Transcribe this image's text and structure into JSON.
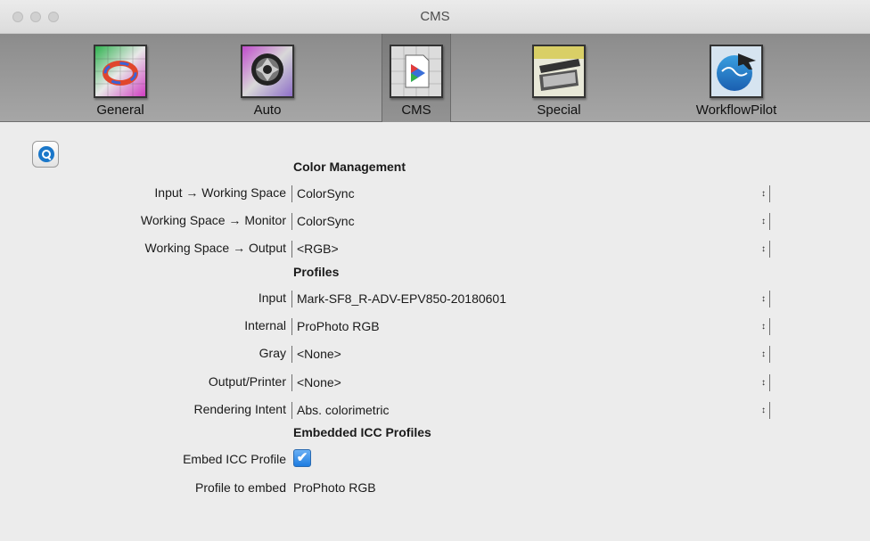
{
  "window": {
    "title": "CMS"
  },
  "toolbar": {
    "tabs": [
      {
        "label": "General",
        "icon": "general-icon"
      },
      {
        "label": "Auto",
        "icon": "aperture-icon"
      },
      {
        "label": "CMS",
        "icon": "color-profile-icon",
        "selected": true
      },
      {
        "label": "Special",
        "icon": "scanner-icon"
      },
      {
        "label": "WorkflowPilot",
        "icon": "globe-plane-icon"
      }
    ]
  },
  "help": {
    "icon": "help-icon"
  },
  "color_management": {
    "heading": "Color Management",
    "input_to_working": {
      "label": "Input → Working Space",
      "value": "ColorSync"
    },
    "working_to_monitor": {
      "label": "Working Space → Monitor",
      "value": "ColorSync"
    },
    "working_to_output": {
      "label": "Working Space → Output",
      "value": "<RGB>"
    }
  },
  "profiles": {
    "heading": "Profiles",
    "input": {
      "label": "Input",
      "value": "Mark-SF8_R-ADV-EPV850-20180601"
    },
    "internal": {
      "label": "Internal",
      "value": "ProPhoto RGB"
    },
    "gray": {
      "label": "Gray",
      "value": "<None>"
    },
    "output_printer": {
      "label": "Output/Printer",
      "value": "<None>"
    },
    "rendering_intent": {
      "label": "Rendering Intent",
      "value": "Abs. colorimetric"
    }
  },
  "embedded": {
    "heading": "Embedded ICC Profiles",
    "embed_icc": {
      "label": "Embed ICC Profile",
      "checked": true,
      "mark": "✔"
    },
    "profile_to_embed": {
      "label": "Profile to embed",
      "value": "ProPhoto RGB"
    }
  },
  "select_arrow": "↕",
  "colors": {
    "accent": "#1d7ce0",
    "toolbar": "#9a9a9a"
  }
}
